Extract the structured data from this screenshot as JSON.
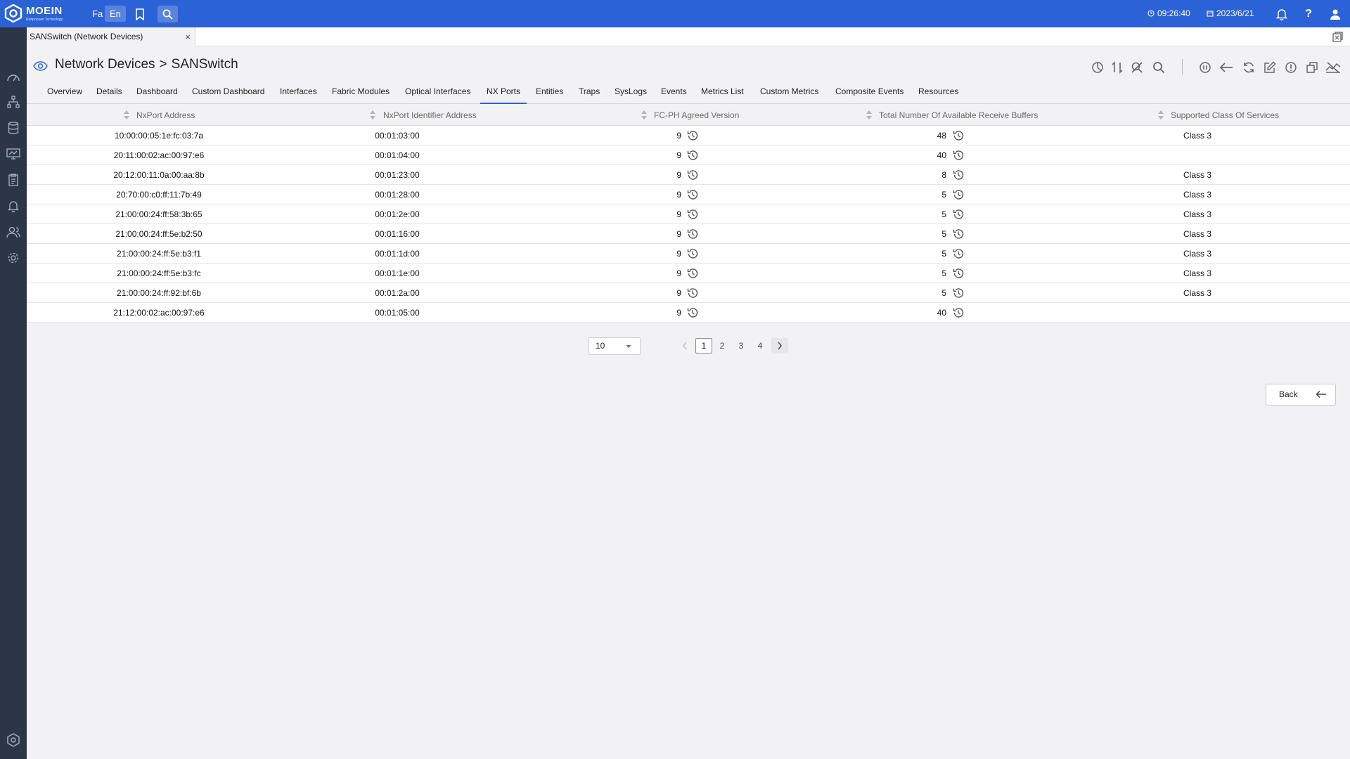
{
  "header": {
    "logo_text": "MOEIN",
    "logo_subtext": "Rahpooyan Technology",
    "lang_fa": "Fa",
    "lang_en": "En",
    "time": "09:26:40",
    "date": "2023/6/21"
  },
  "doc_tab": {
    "label": "SANSwitch (Network Devices)",
    "close": "×"
  },
  "page": {
    "title_parent": "Network Devices",
    "title_separator": ">",
    "title_current": "SANSwitch"
  },
  "nav_tabs": [
    "Overview",
    "Details",
    "Dashboard",
    "Custom Dashboard",
    "Interfaces",
    "Fabric Modules",
    "Optical Interfaces",
    "NX Ports",
    "Entities",
    "Traps",
    "SysLogs",
    "Events",
    "Metrics List",
    "Custom Metrics",
    "Composite Events",
    "Resources"
  ],
  "active_tab": "NX Ports",
  "table": {
    "columns": [
      "NxPort Address",
      "NxPort Identifier Address",
      "FC-PH Agreed Version",
      "Total Number Of Available Receive Buffers",
      "Supported Class Of Services"
    ],
    "rows": [
      [
        "10:00:00:05:1e:fc:03:7a",
        "00:01:03:00",
        "9",
        "48",
        "Class 3"
      ],
      [
        "20:11:00:02:ac:00:97:e6",
        "00:01:04:00",
        "9",
        "40",
        ""
      ],
      [
        "20:12:00:11:0a:00:aa:8b",
        "00:01:23:00",
        "9",
        "8",
        "Class 3"
      ],
      [
        "20:70:00:c0:ff:11:7b:49",
        "00:01:28:00",
        "9",
        "5",
        "Class 3"
      ],
      [
        "21:00:00:24:ff:58:3b:65",
        "00:01:2e:00",
        "9",
        "5",
        "Class 3"
      ],
      [
        "21:00:00:24:ff:5e:b2:50",
        "00:01:16:00",
        "9",
        "5",
        "Class 3"
      ],
      [
        "21:00:00:24:ff:5e:b3:f1",
        "00:01:1d:00",
        "9",
        "5",
        "Class 3"
      ],
      [
        "21:00:00:24:ff:5e:b3:fc",
        "00:01:1e:00",
        "9",
        "5",
        "Class 3"
      ],
      [
        "21:00:00:24:ff:92:bf:6b",
        "00:01:2a:00",
        "9",
        "5",
        "Class 3"
      ],
      [
        "21:12:00:02:ac:00:97:e6",
        "00:01:05:00",
        "9",
        "40",
        ""
      ]
    ]
  },
  "pagination": {
    "page_size": "10",
    "pages": [
      "1",
      "2",
      "3",
      "4"
    ],
    "current_page": "1"
  },
  "back_button": "Back",
  "colors": {
    "topbar": "#2b62d5",
    "sidebar": "#2c3648",
    "accent": "#2b62d5",
    "background": "#f2f2f4"
  },
  "icons": {
    "topbar": [
      "logo-icon",
      "bookmark-icon",
      "search-icon",
      "clock-icon",
      "calendar-icon",
      "bell-icon",
      "help-icon",
      "user-icon"
    ],
    "sidebar": [
      "dashboard-gauge-icon",
      "topology-icon",
      "database-icon",
      "monitor-icon",
      "report-icon",
      "alarm-icon",
      "users-icon",
      "settings-icon",
      "brand-icon"
    ],
    "toolbar": [
      "chart-pie-icon",
      "sort-icon",
      "search-off-icon",
      "search-icon",
      "pause-icon",
      "back-arrow-icon",
      "refresh-icon",
      "edit-icon",
      "alert-icon",
      "copy-icon",
      "chart-off-icon"
    ]
  }
}
